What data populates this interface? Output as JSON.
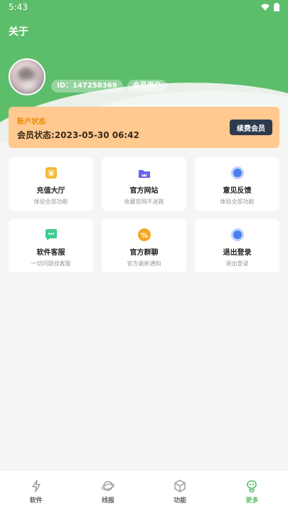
{
  "status_bar": {
    "time": "5:43"
  },
  "page": {
    "title": "关于"
  },
  "profile": {
    "id_chip": "ID：147258369",
    "member_chip": "会员用户"
  },
  "account": {
    "label": "账户状态",
    "status_text": "会员状态:2023-05-30 06:42",
    "renew_button": "续费会员"
  },
  "tiles": [
    {
      "title": "充值大厅",
      "subtitle": "体验全部功能",
      "icon": "yen-card-icon",
      "color": "#f5b731"
    },
    {
      "title": "官方网站",
      "subtitle": "收藏官网不迷路",
      "icon": "crown-folder-icon",
      "color": "#6b63e8"
    },
    {
      "title": "意见反馈",
      "subtitle": "体验全部功能",
      "icon": "feedback-circle-icon",
      "color": "#4c7df0"
    },
    {
      "title": "软件客服",
      "subtitle": "一切问题找客服",
      "icon": "chat-bubble-icon",
      "color": "#3dcc8f"
    },
    {
      "title": "官方群聊",
      "subtitle": "官方最新通知",
      "icon": "percent-badge-icon",
      "color": "#f5a623"
    },
    {
      "title": "退出登录",
      "subtitle": "退出登录",
      "icon": "logout-circle-icon",
      "color": "#4c7df0"
    }
  ],
  "nav": [
    {
      "label": "软件",
      "icon": "lightning-icon",
      "active": false
    },
    {
      "label": "线报",
      "icon": "planet-icon",
      "active": false
    },
    {
      "label": "功能",
      "icon": "cube-icon",
      "active": false
    },
    {
      "label": "更多",
      "icon": "robot-icon",
      "active": true
    }
  ],
  "colors": {
    "brand_green": "#5cbd6a",
    "card_orange": "#ffc98f",
    "label_orange": "#f08a00",
    "dark_button": "#2f3b4d"
  }
}
